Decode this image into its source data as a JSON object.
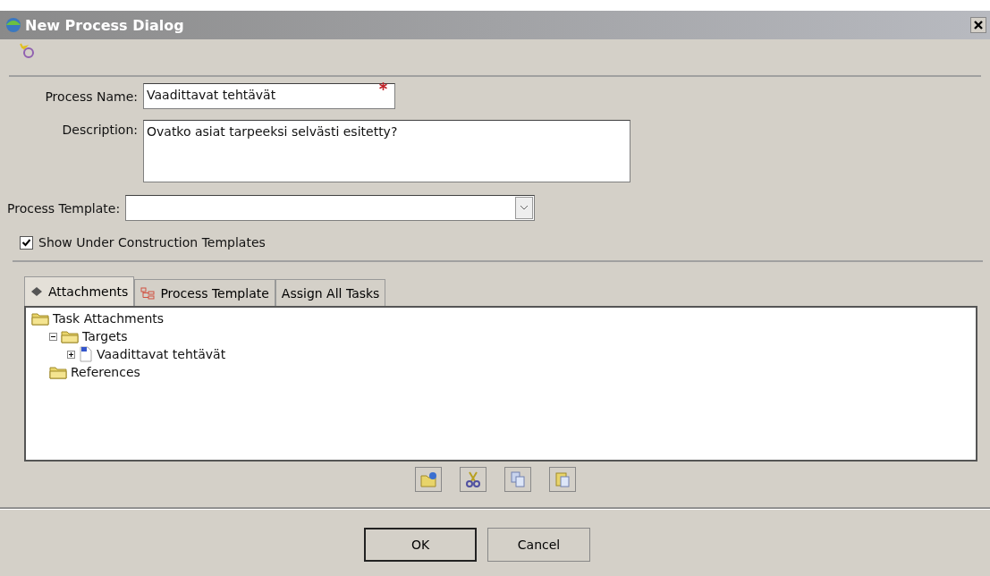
{
  "window": {
    "title": "New Process Dialog"
  },
  "form": {
    "process_name": {
      "label": "Process Name:",
      "value": "Vaadittavat tehtävät",
      "required": true
    },
    "description": {
      "label": "Description:",
      "value": "Ovatko asiat tarpeeksi selvästi esitetty?"
    },
    "process_template": {
      "label": "Process Template:"
    },
    "show_under_construction": {
      "label": "Show Under Construction Templates",
      "checked": true
    }
  },
  "tabs": [
    {
      "label": "Attachments",
      "kind": "clip",
      "selected": true
    },
    {
      "label": "Process Template",
      "kind": "tree",
      "selected": false
    },
    {
      "label": "Assign All Tasks",
      "kind": "none",
      "selected": false
    }
  ],
  "tree": [
    {
      "label": "Task Attachments",
      "kind": "folder",
      "children": [
        {
          "label": "Targets",
          "kind": "folder",
          "expanded": true,
          "children": [
            {
              "label": "Vaadittavat tehtävät",
              "kind": "document",
              "expanded": false
            }
          ]
        },
        {
          "label": "References",
          "kind": "folder"
        }
      ]
    }
  ],
  "toolbar": [
    {
      "kind": "open"
    },
    {
      "kind": "cut"
    },
    {
      "kind": "copy"
    },
    {
      "kind": "paste"
    }
  ],
  "buttons": [
    {
      "label": "OK",
      "default": true
    },
    {
      "label": "Cancel",
      "default": false
    }
  ]
}
